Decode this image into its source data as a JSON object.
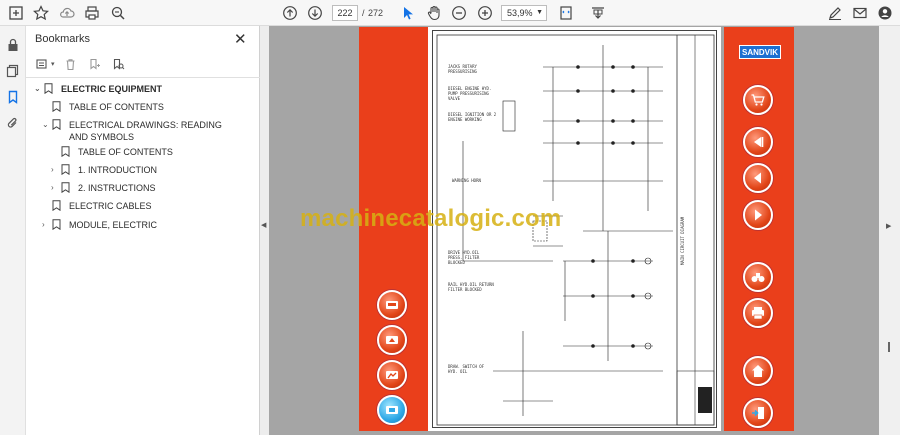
{
  "toolbar": {
    "page_current": "222",
    "page_separator": "/",
    "page_total": "272",
    "zoom": "53,9%"
  },
  "bookmarks_panel": {
    "title": "Bookmarks",
    "items": [
      {
        "label": "ELECTRIC EQUIPMENT",
        "level": 0,
        "expanded": true
      },
      {
        "label": "TABLE OF CONTENTS",
        "level": 1
      },
      {
        "label": "ELECTRICAL DRAWINGS: READING AND SYMBOLS",
        "level": 1,
        "expanded": true
      },
      {
        "label": "TABLE OF CONTENTS",
        "level": 2
      },
      {
        "label": "1. INTRODUCTION",
        "level": 2,
        "collapsed": true
      },
      {
        "label": "2. INSTRUCTIONS",
        "level": 2,
        "collapsed": true
      },
      {
        "label": "ELECTRIC CABLES",
        "level": 1
      },
      {
        "label": "MODULE, ELECTRIC",
        "level": 1,
        "collapsed": true
      }
    ]
  },
  "document": {
    "brand": "SANDVIK",
    "watermark": "machinecatalogic.com",
    "schematic_labels": [
      "JACKS ROTARY PRESSURISING",
      "DIESEL ENGINE HYD. PUMP PRESSURISING VALVE",
      "DIESEL IGNITION OR 2 ENGINE WORKING",
      "WARNING HORN",
      "DRIVE HYD.OIL PRESS. FILTER BLOCKED",
      "RAIL HYD.OIL RETURN FILTER BLOCKED",
      "DRAW. SWITCH OF HYD. OIL"
    ],
    "title_block": "MAIN CIRCUIT DIAGRAM"
  },
  "colors": {
    "nav_bar": "#ea3f1b",
    "brand_blue": "#1d6fd1",
    "watermark": "#d6b012"
  }
}
